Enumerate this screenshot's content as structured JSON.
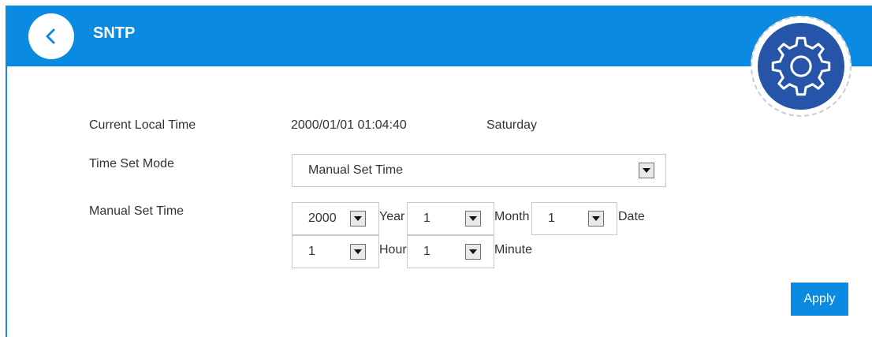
{
  "header": {
    "title": "SNTP",
    "back_icon": "chevron-left-icon",
    "settings_icon": "gear-icon",
    "accent_color": "#0a8ae0"
  },
  "form": {
    "current_local_time": {
      "label": "Current Local Time",
      "datetime": "2000/01/01 01:04:40",
      "weekday": "Saturday"
    },
    "time_set_mode": {
      "label": "Time Set Mode",
      "selected": "Manual Set Time"
    },
    "manual_set_time": {
      "label": "Manual Set Time",
      "year": {
        "selected": "2000",
        "unit": "Year"
      },
      "month": {
        "selected": "1",
        "unit": "Month"
      },
      "date": {
        "selected": "1",
        "unit": "Date"
      },
      "hour": {
        "selected": "1",
        "unit": "Hour"
      },
      "minute": {
        "selected": "1",
        "unit": "Minute"
      }
    }
  },
  "actions": {
    "apply_label": "Apply"
  }
}
